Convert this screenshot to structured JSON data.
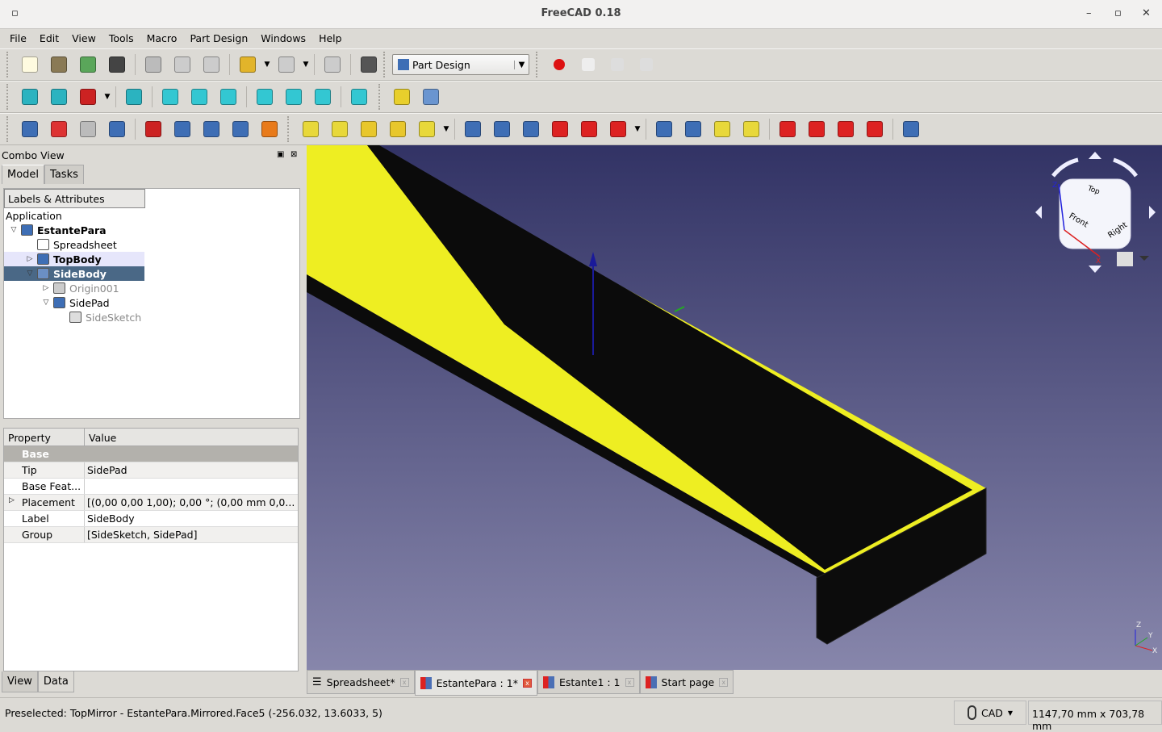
{
  "window": {
    "title": "FreeCAD 0.18"
  },
  "menu": [
    "File",
    "Edit",
    "View",
    "Tools",
    "Macro",
    "Part Design",
    "Windows",
    "Help"
  ],
  "toolbars": {
    "row1": [
      [
        "new-document-icon",
        "#fffbe0"
      ],
      [
        "open-icon",
        "#8a7a55"
      ],
      [
        "save-icon",
        "#5aa65a"
      ],
      [
        "print-icon",
        "#444"
      ],
      "|",
      [
        "cut-icon",
        "#bbb"
      ],
      [
        "copy-icon",
        "#ccc"
      ],
      [
        "paste-icon",
        "#ccc"
      ],
      "|",
      [
        "undo-icon",
        "#e2b42a"
      ],
      "v",
      [
        "redo-icon",
        "#ccc"
      ],
      "v",
      "|",
      [
        "refresh-icon",
        "#ccc"
      ],
      "|",
      [
        "whats-this-icon",
        "#555"
      ]
    ],
    "row2": [
      [
        "fit-all-icon",
        "#2bb3c0"
      ],
      [
        "fit-selection-icon",
        "#2bb3c0"
      ],
      [
        "draw-style-icon",
        "#c22"
      ],
      "v",
      "|",
      [
        "isometric-view-icon",
        "#2bb3c0"
      ],
      "|",
      [
        "front-view-icon",
        "#33c7d2"
      ],
      [
        "top-view-icon",
        "#33c7d2"
      ],
      [
        "right-view-icon",
        "#33c7d2"
      ],
      "|",
      [
        "rear-view-icon",
        "#33c7d2"
      ],
      [
        "bottom-view-icon",
        "#33c7d2"
      ],
      [
        "left-view-icon",
        "#33c7d2"
      ],
      "|",
      [
        "measure-distance-icon",
        "#33c7d2"
      ]
    ],
    "row2b": [
      [
        "create-part-icon",
        "#e8cf2c"
      ],
      [
        "create-group-icon",
        "#6a95d0"
      ]
    ],
    "row3a": [
      [
        "body-icon",
        "#3e6eb5"
      ],
      [
        "sketch-icon",
        "#d33"
      ],
      [
        "shape-binder-icon",
        "#bbb"
      ],
      [
        "clone-icon",
        "#3e6eb5"
      ],
      "|",
      [
        "datum-point-icon",
        "#c22"
      ],
      [
        "datum-line-icon",
        "#3e6eb5"
      ],
      [
        "datum-plane-icon",
        "#3e6eb5"
      ],
      [
        "local-cs-icon",
        "#3e6eb5"
      ],
      [
        "shape-binder2-icon",
        "#e87a1a"
      ]
    ],
    "row3b": [
      [
        "pad-icon",
        "#e8d83a"
      ],
      [
        "revolution-icon",
        "#e8d83a"
      ],
      [
        "additive-loft-icon",
        "#e8c72c"
      ],
      [
        "additive-pipe-icon",
        "#e8c72c"
      ],
      [
        "additive-primitive-icon",
        "#e8d83a"
      ],
      "v",
      "|",
      [
        "pocket-icon",
        "#3e6eb5"
      ],
      [
        "hole-icon",
        "#3e6eb5"
      ],
      [
        "groove-icon",
        "#3e6eb5"
      ],
      [
        "subtractive-loft-icon",
        "#d22"
      ],
      [
        "subtractive-pipe-icon",
        "#d22"
      ],
      [
        "subtractive-primitive-icon",
        "#d22"
      ],
      "v",
      "|",
      [
        "mirrored-icon",
        "#3e6eb5"
      ],
      [
        "linear-pattern-icon",
        "#3e6eb5"
      ],
      [
        "polar-pattern-icon",
        "#e8d83a"
      ],
      [
        "multi-transform-icon",
        "#e8d83a"
      ],
      "|",
      [
        "fillet-icon",
        "#d22"
      ],
      [
        "chamfer-icon",
        "#d22"
      ],
      [
        "draft-icon",
        "#d22"
      ],
      [
        "thickness-icon",
        "#d22"
      ],
      "|",
      [
        "boolean-icon",
        "#3e6eb5"
      ]
    ],
    "workbench": "Part Design",
    "macro": [
      [
        "record-macro-icon",
        "#d11"
      ],
      [
        "stop-macro-icon",
        "#eee"
      ],
      [
        "edit-macro-icon",
        "#ddd"
      ],
      [
        "run-macro-icon",
        "#ddd"
      ]
    ]
  },
  "combo": {
    "title": "Combo View",
    "tabs": [
      "Model",
      "Tasks"
    ],
    "tree_header": "Labels & Attributes",
    "application": "Application",
    "tree": [
      {
        "label": "EstantePara",
        "indent": 0,
        "toggle": "▽",
        "bold": true,
        "icon": "document-icon",
        "color": "#3e6eb5"
      },
      {
        "label": "Spreadsheet",
        "indent": 1,
        "toggle": "",
        "icon": "spreadsheet-icon",
        "color": "#fff"
      },
      {
        "label": "TopBody",
        "indent": 1,
        "toggle": "▷",
        "bold": true,
        "icon": "body-icon",
        "color": "#3e6eb5",
        "state": "preselected"
      },
      {
        "label": "SideBody",
        "indent": 1,
        "toggle": "▽",
        "bold": true,
        "icon": "body-icon",
        "color": "#6b8fc4",
        "state": "selected"
      },
      {
        "label": "Origin001",
        "indent": 2,
        "toggle": "▷",
        "icon": "origin-icon",
        "color": "#ccc",
        "muted": true
      },
      {
        "label": "SidePad",
        "indent": 2,
        "toggle": "▽",
        "icon": "pad-icon",
        "color": "#3e6eb5"
      },
      {
        "label": "SideSketch",
        "indent": 3,
        "toggle": "",
        "icon": "sketch-icon",
        "color": "#ddd",
        "muted": true
      }
    ]
  },
  "properties": {
    "headers": [
      "Property",
      "Value"
    ],
    "group": "Base",
    "rows": [
      {
        "k": "Tip",
        "v": "SidePad"
      },
      {
        "k": "Base Feat...",
        "v": ""
      },
      {
        "k": "Placement",
        "v": "[(0,00 0,00 1,00); 0,00 °; (0,00 mm  0,0...",
        "expand": true
      },
      {
        "k": "Label",
        "v": "SideBody"
      },
      {
        "k": "Group",
        "v": "[SideSketch, SidePad]"
      }
    ]
  },
  "bottom_tabs": [
    "View",
    "Data"
  ],
  "navcube": {
    "faces": [
      "Top",
      "Front",
      "Right"
    ],
    "axes": [
      "Z",
      "X",
      "Y"
    ]
  },
  "doc_tabs": [
    {
      "label": "Spreadsheet*",
      "icon": "spreadsheet-icon"
    },
    {
      "label": "EstantePara : 1*",
      "icon": "freecad-doc-icon",
      "active": true
    },
    {
      "label": "Estante1 : 1",
      "icon": "freecad-doc-icon"
    },
    {
      "label": "Start page",
      "icon": "freecad-doc-icon"
    }
  ],
  "status": {
    "message": "Preselected: TopMirror - EstantePara.Mirrored.Face5 (-256.032, 13.6033, 5)",
    "nav_style": "CAD",
    "dimensions": "1147,70 mm x 703,78 mm"
  },
  "colors": {
    "viewport_top": "#323365",
    "viewport_bottom": "#8786ab",
    "face_highlight": "#eeee22",
    "selection": "#4a6886"
  }
}
